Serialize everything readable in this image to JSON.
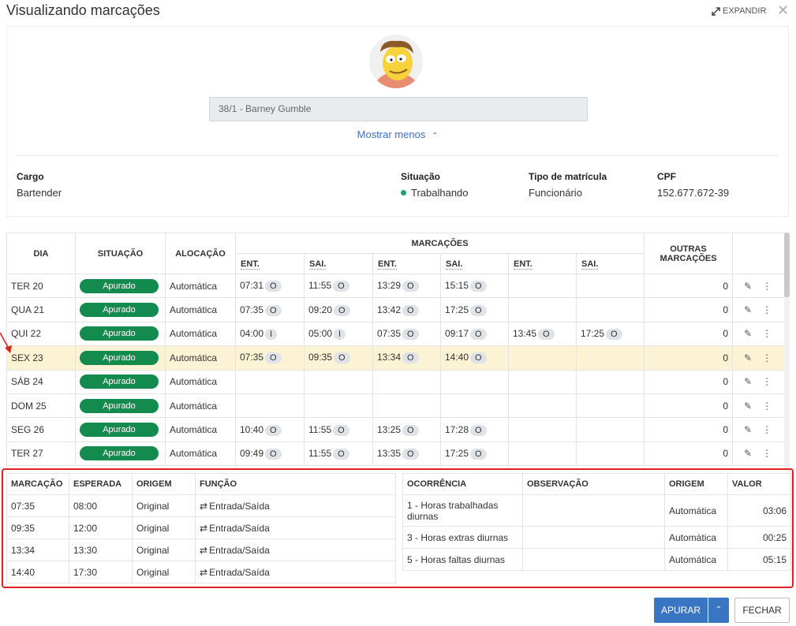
{
  "header": {
    "title": "Visualizando marcações",
    "expand_label": "EXPANDIR",
    "close_glyph": "✕"
  },
  "profile": {
    "employee": "38/1 - Barney Gumble",
    "show_less": "Mostrar menos",
    "cargo_label": "Cargo",
    "cargo": "Bartender",
    "situacao_label": "Situação",
    "situacao": "Trabalhando",
    "tipo_label": "Tipo de matrícula",
    "tipo": "Funcionário",
    "cpf_label": "CPF",
    "cpf": "152.677.672-39",
    "status_color": "#1ea36b"
  },
  "grid": {
    "h_dia": "DIA",
    "h_situacao": "SITUAÇÃO",
    "h_alocacao": "ALOCAÇÃO",
    "h_marcacoes": "MARCAÇÕES",
    "h_outras": "OUTRAS MARCAÇÕES",
    "h_ent": "ENT.",
    "h_sai": "SAI.",
    "rows": [
      {
        "dia": "TER 20",
        "situacao": "Apurado",
        "alocacao": "Automática",
        "p": [
          [
            "07:31",
            "O"
          ],
          [
            "11:55",
            "O"
          ],
          [
            "13:29",
            "O"
          ],
          [
            "15:15",
            "O"
          ],
          [
            "",
            ""
          ],
          [
            "",
            ""
          ]
        ],
        "outras": "0"
      },
      {
        "dia": "QUA 21",
        "situacao": "Apurado",
        "alocacao": "Automática",
        "p": [
          [
            "07:35",
            "O"
          ],
          [
            "09:20",
            "O"
          ],
          [
            "13:42",
            "O"
          ],
          [
            "17:25",
            "O"
          ],
          [
            "",
            ""
          ],
          [
            "",
            ""
          ]
        ],
        "outras": "0"
      },
      {
        "dia": "QUI 22",
        "situacao": "Apurado",
        "alocacao": "Automática",
        "p": [
          [
            "04:00",
            "I"
          ],
          [
            "05:00",
            "I"
          ],
          [
            "07:35",
            "O"
          ],
          [
            "09:17",
            "O"
          ],
          [
            "13:45",
            "O"
          ],
          [
            "17:25",
            "O"
          ]
        ],
        "outras": "0"
      },
      {
        "dia": "SEX 23",
        "situacao": "Apurado",
        "alocacao": "Automática",
        "p": [
          [
            "07:35",
            "O"
          ],
          [
            "09:35",
            "O"
          ],
          [
            "13:34",
            "O"
          ],
          [
            "14:40",
            "O"
          ],
          [
            "",
            ""
          ],
          [
            "",
            ""
          ]
        ],
        "outras": "0"
      },
      {
        "dia": "SÁB 24",
        "situacao": "Apurado",
        "alocacao": "Automática",
        "p": [
          [
            "",
            ""
          ],
          [
            "",
            ""
          ],
          [
            "",
            ""
          ],
          [
            "",
            ""
          ],
          [
            "",
            ""
          ],
          [
            "",
            ""
          ]
        ],
        "outras": "0"
      },
      {
        "dia": "DOM 25",
        "situacao": "Apurado",
        "alocacao": "Automática",
        "p": [
          [
            "",
            ""
          ],
          [
            "",
            ""
          ],
          [
            "",
            ""
          ],
          [
            "",
            ""
          ],
          [
            "",
            ""
          ],
          [
            "",
            ""
          ]
        ],
        "outras": "0"
      },
      {
        "dia": "SEG 26",
        "situacao": "Apurado",
        "alocacao": "Automática",
        "p": [
          [
            "10:40",
            "O"
          ],
          [
            "11:55",
            "O"
          ],
          [
            "13:25",
            "O"
          ],
          [
            "17:28",
            "O"
          ],
          [
            "",
            ""
          ],
          [
            "",
            ""
          ]
        ],
        "outras": "0"
      },
      {
        "dia": "TER 27",
        "situacao": "Apurado",
        "alocacao": "Automática",
        "p": [
          [
            "09:49",
            "O"
          ],
          [
            "11:55",
            "O"
          ],
          [
            "13:35",
            "O"
          ],
          [
            "17:25",
            "O"
          ],
          [
            "",
            ""
          ],
          [
            "",
            ""
          ]
        ],
        "outras": "0"
      }
    ],
    "selected_row": 3,
    "pill_color": "#138a4e",
    "highlight_color": "#fcf3d4"
  },
  "detail_left": {
    "headers": [
      "MARCAÇÃO",
      "ESPERADA",
      "ORIGEM",
      "FUNÇÃO"
    ],
    "rows": [
      [
        "07:35",
        "08:00",
        "Original",
        "Entrada/Saída"
      ],
      [
        "09:35",
        "12:00",
        "Original",
        "Entrada/Saída"
      ],
      [
        "13:34",
        "13:30",
        "Original",
        "Entrada/Saída"
      ],
      [
        "14:40",
        "17:30",
        "Original",
        "Entrada/Saída"
      ]
    ]
  },
  "detail_right": {
    "headers": [
      "OCORRÊNCIA",
      "OBSERVAÇÃO",
      "ORIGEM",
      "VALOR"
    ],
    "rows": [
      [
        "1 - Horas trabalhadas diurnas",
        "",
        "Automática",
        "03:06"
      ],
      [
        "3 - Horas extras diurnas",
        "",
        "Automática",
        "00:25"
      ],
      [
        "5 - Horas faltas diurnas",
        "",
        "Automática",
        "05:15"
      ]
    ]
  },
  "footer": {
    "apurar": "APURAR",
    "fechar": "FECHAR"
  }
}
